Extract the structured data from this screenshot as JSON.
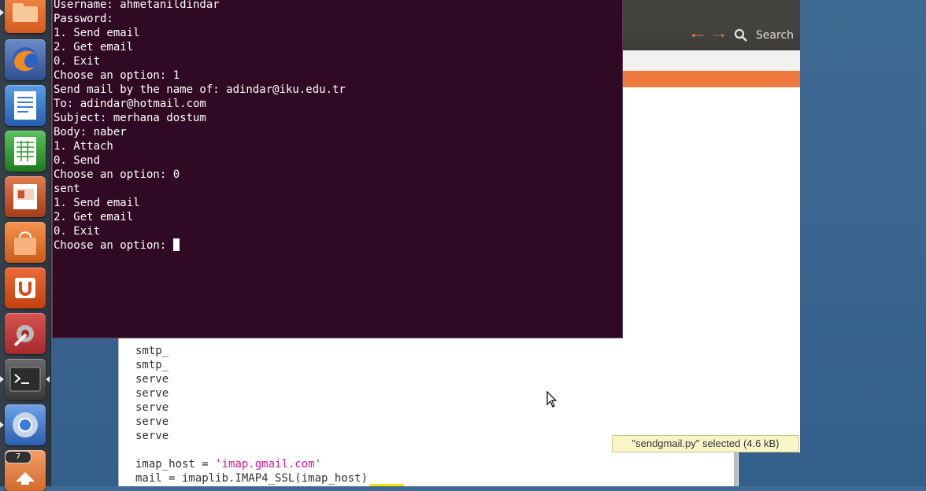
{
  "launcher": {
    "items": [
      {
        "name": "files",
        "icon": "folder-icon",
        "color": "#e26a2a"
      },
      {
        "name": "firefox",
        "icon": "firefox-icon",
        "color": "#e66000"
      },
      {
        "name": "writer",
        "icon": "libreoffice-writer-icon",
        "color": "#3a7bd5"
      },
      {
        "name": "calc",
        "icon": "libreoffice-calc-icon",
        "color": "#2f9a2f"
      },
      {
        "name": "impress",
        "icon": "libreoffice-impress-icon",
        "color": "#c7552c"
      },
      {
        "name": "software-center",
        "icon": "shopping-bag-icon",
        "color": "#e8742e"
      },
      {
        "name": "ubuntu-one",
        "icon": "ubuntu-one-icon",
        "color": "#dd4814"
      },
      {
        "name": "system-settings",
        "icon": "settings-wrench-icon",
        "color": "#c0392b"
      },
      {
        "name": "terminal",
        "icon": "terminal-icon",
        "color": "#2c2c2c"
      },
      {
        "name": "chromium",
        "icon": "chromium-icon",
        "color": "#3b7bd9"
      },
      {
        "name": "update-manager",
        "icon": "update-arrow-icon",
        "color": "#e8742e"
      }
    ],
    "update_badge": "7"
  },
  "file_manager": {
    "search_label": "Search",
    "status_tip": "\"sendgmail.py\" selected (4.6 kB)"
  },
  "editor": {
    "lines": [
      {
        "code": "smtp_"
      },
      {
        "code": "smtp_"
      },
      {
        "code": "serve"
      },
      {
        "code": "serve"
      },
      {
        "code": "serve"
      },
      {
        "code": "serve"
      },
      {
        "code": "serve"
      }
    ],
    "imap_host_prefix": "imap_host = ",
    "imap_host_value": "'imap.gmail.com'",
    "mail_line": "mail = imaplib.IMAP4_SSL(imap_host)"
  },
  "terminal": {
    "lines": [
      "Username: ahmetanildindar",
      "Password:",
      "1. Send email",
      "2. Get email",
      "0. Exit",
      "Choose an option: 1",
      "Send mail by the name of: adindar@iku.edu.tr",
      "To: adindar@hotmail.com",
      "Subject: merhana dostum",
      "Body: naber",
      "1. Attach",
      "0. Send",
      "Choose an option: 0",
      "sent",
      "1. Send email",
      "2. Get email",
      "0. Exit"
    ],
    "prompt": "Choose an option: "
  }
}
